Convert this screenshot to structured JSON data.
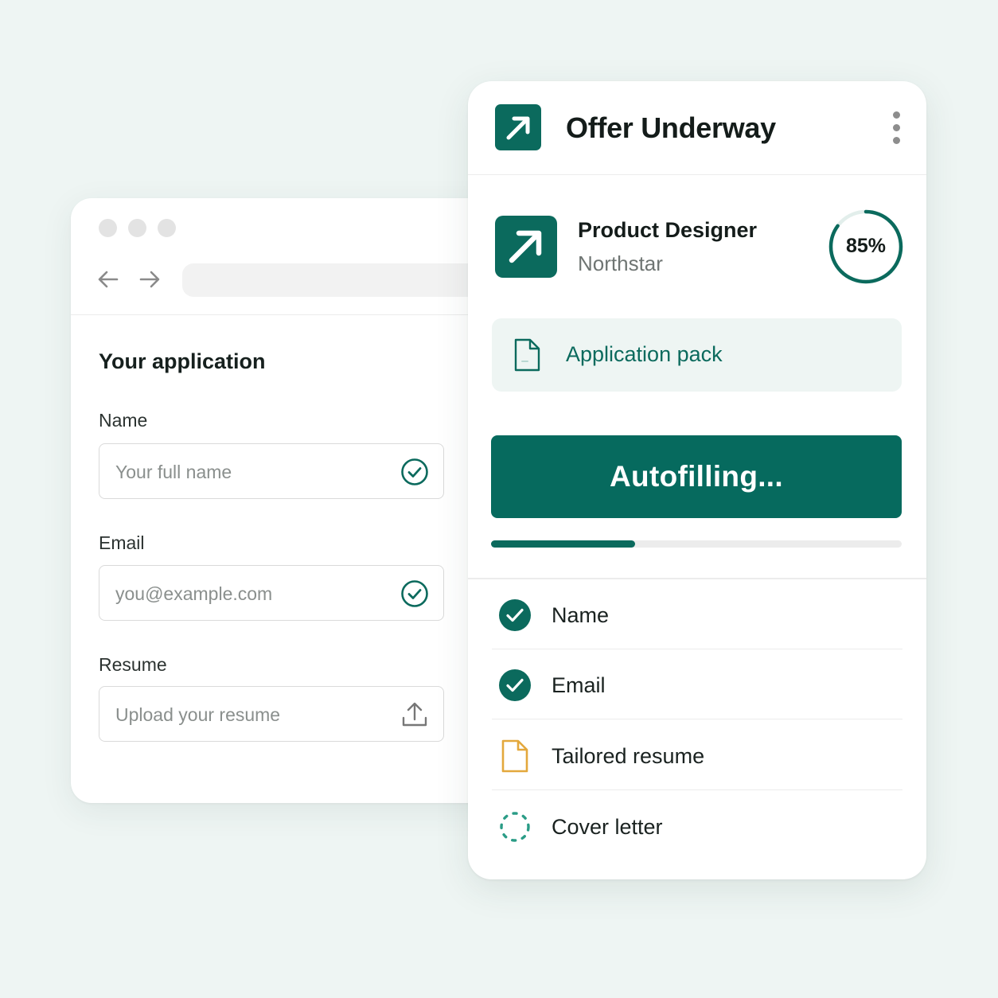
{
  "browser": {
    "form_title": "Your application",
    "fields": [
      {
        "label": "Name",
        "placeholder": "Your full name",
        "status_icon": "check-circle-icon"
      },
      {
        "label": "Email",
        "placeholder": "you@example.com",
        "status_icon": "check-circle-icon"
      },
      {
        "label": "Resume",
        "placeholder": "Upload your resume",
        "status_icon": "upload-icon"
      }
    ]
  },
  "panel": {
    "title": "Offer Underway",
    "job": {
      "title": "Product Designer",
      "company": "Northstar",
      "match_percent_label": "85%",
      "match_fraction": 0.85
    },
    "pack_label": "Application pack",
    "autofill_label": "Autofilling...",
    "autofill_progress_fraction": 0.35,
    "checklist": [
      {
        "label": "Name",
        "status": "done",
        "icon": "check-filled-icon"
      },
      {
        "label": "Email",
        "status": "done",
        "icon": "check-filled-icon"
      },
      {
        "label": "Tailored resume",
        "status": "document",
        "icon": "document-icon"
      },
      {
        "label": "Cover letter",
        "status": "loading",
        "icon": "spinner-icon"
      }
    ]
  },
  "colors": {
    "brand": "#0b6a5d",
    "background": "#eef5f3",
    "accent_document": "#e3a83c"
  }
}
